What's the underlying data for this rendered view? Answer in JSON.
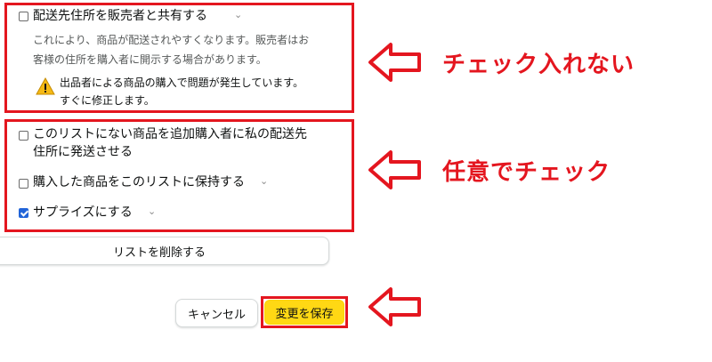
{
  "share_address": {
    "label": "配送先住所を販売者と共有する",
    "checked": false,
    "description_line1": "これにより、商品が配送されやすくなります。販売者はお",
    "description_line2": "客様の住所を購入者に開示する場合があります。",
    "warning_line1": "出品者による商品の購入で問題が発生しています。",
    "warning_line2": "すぐに修正します。"
  },
  "options": {
    "ship_unlisted_line1": "このリストにない商品を追加購入者に私の配送先",
    "ship_unlisted_line2": "住所に発送させる",
    "ship_unlisted_checked": false,
    "keep_purchased": "購入した商品をこのリストに保持する",
    "keep_purchased_checked": false,
    "surprise": "サプライズにする",
    "surprise_checked": true
  },
  "buttons": {
    "delete_list": "リストを削除する",
    "cancel": "キャンセル",
    "save": "変更を保存"
  },
  "annotations": {
    "no_check": "チェック入れない",
    "optional_check": "任意でチェック"
  },
  "colors": {
    "annotation_red": "#e4161f",
    "save_yellow": "#ffd814",
    "checkbox_blue": "#2164d8",
    "warning_yellow": "#f5b915"
  }
}
